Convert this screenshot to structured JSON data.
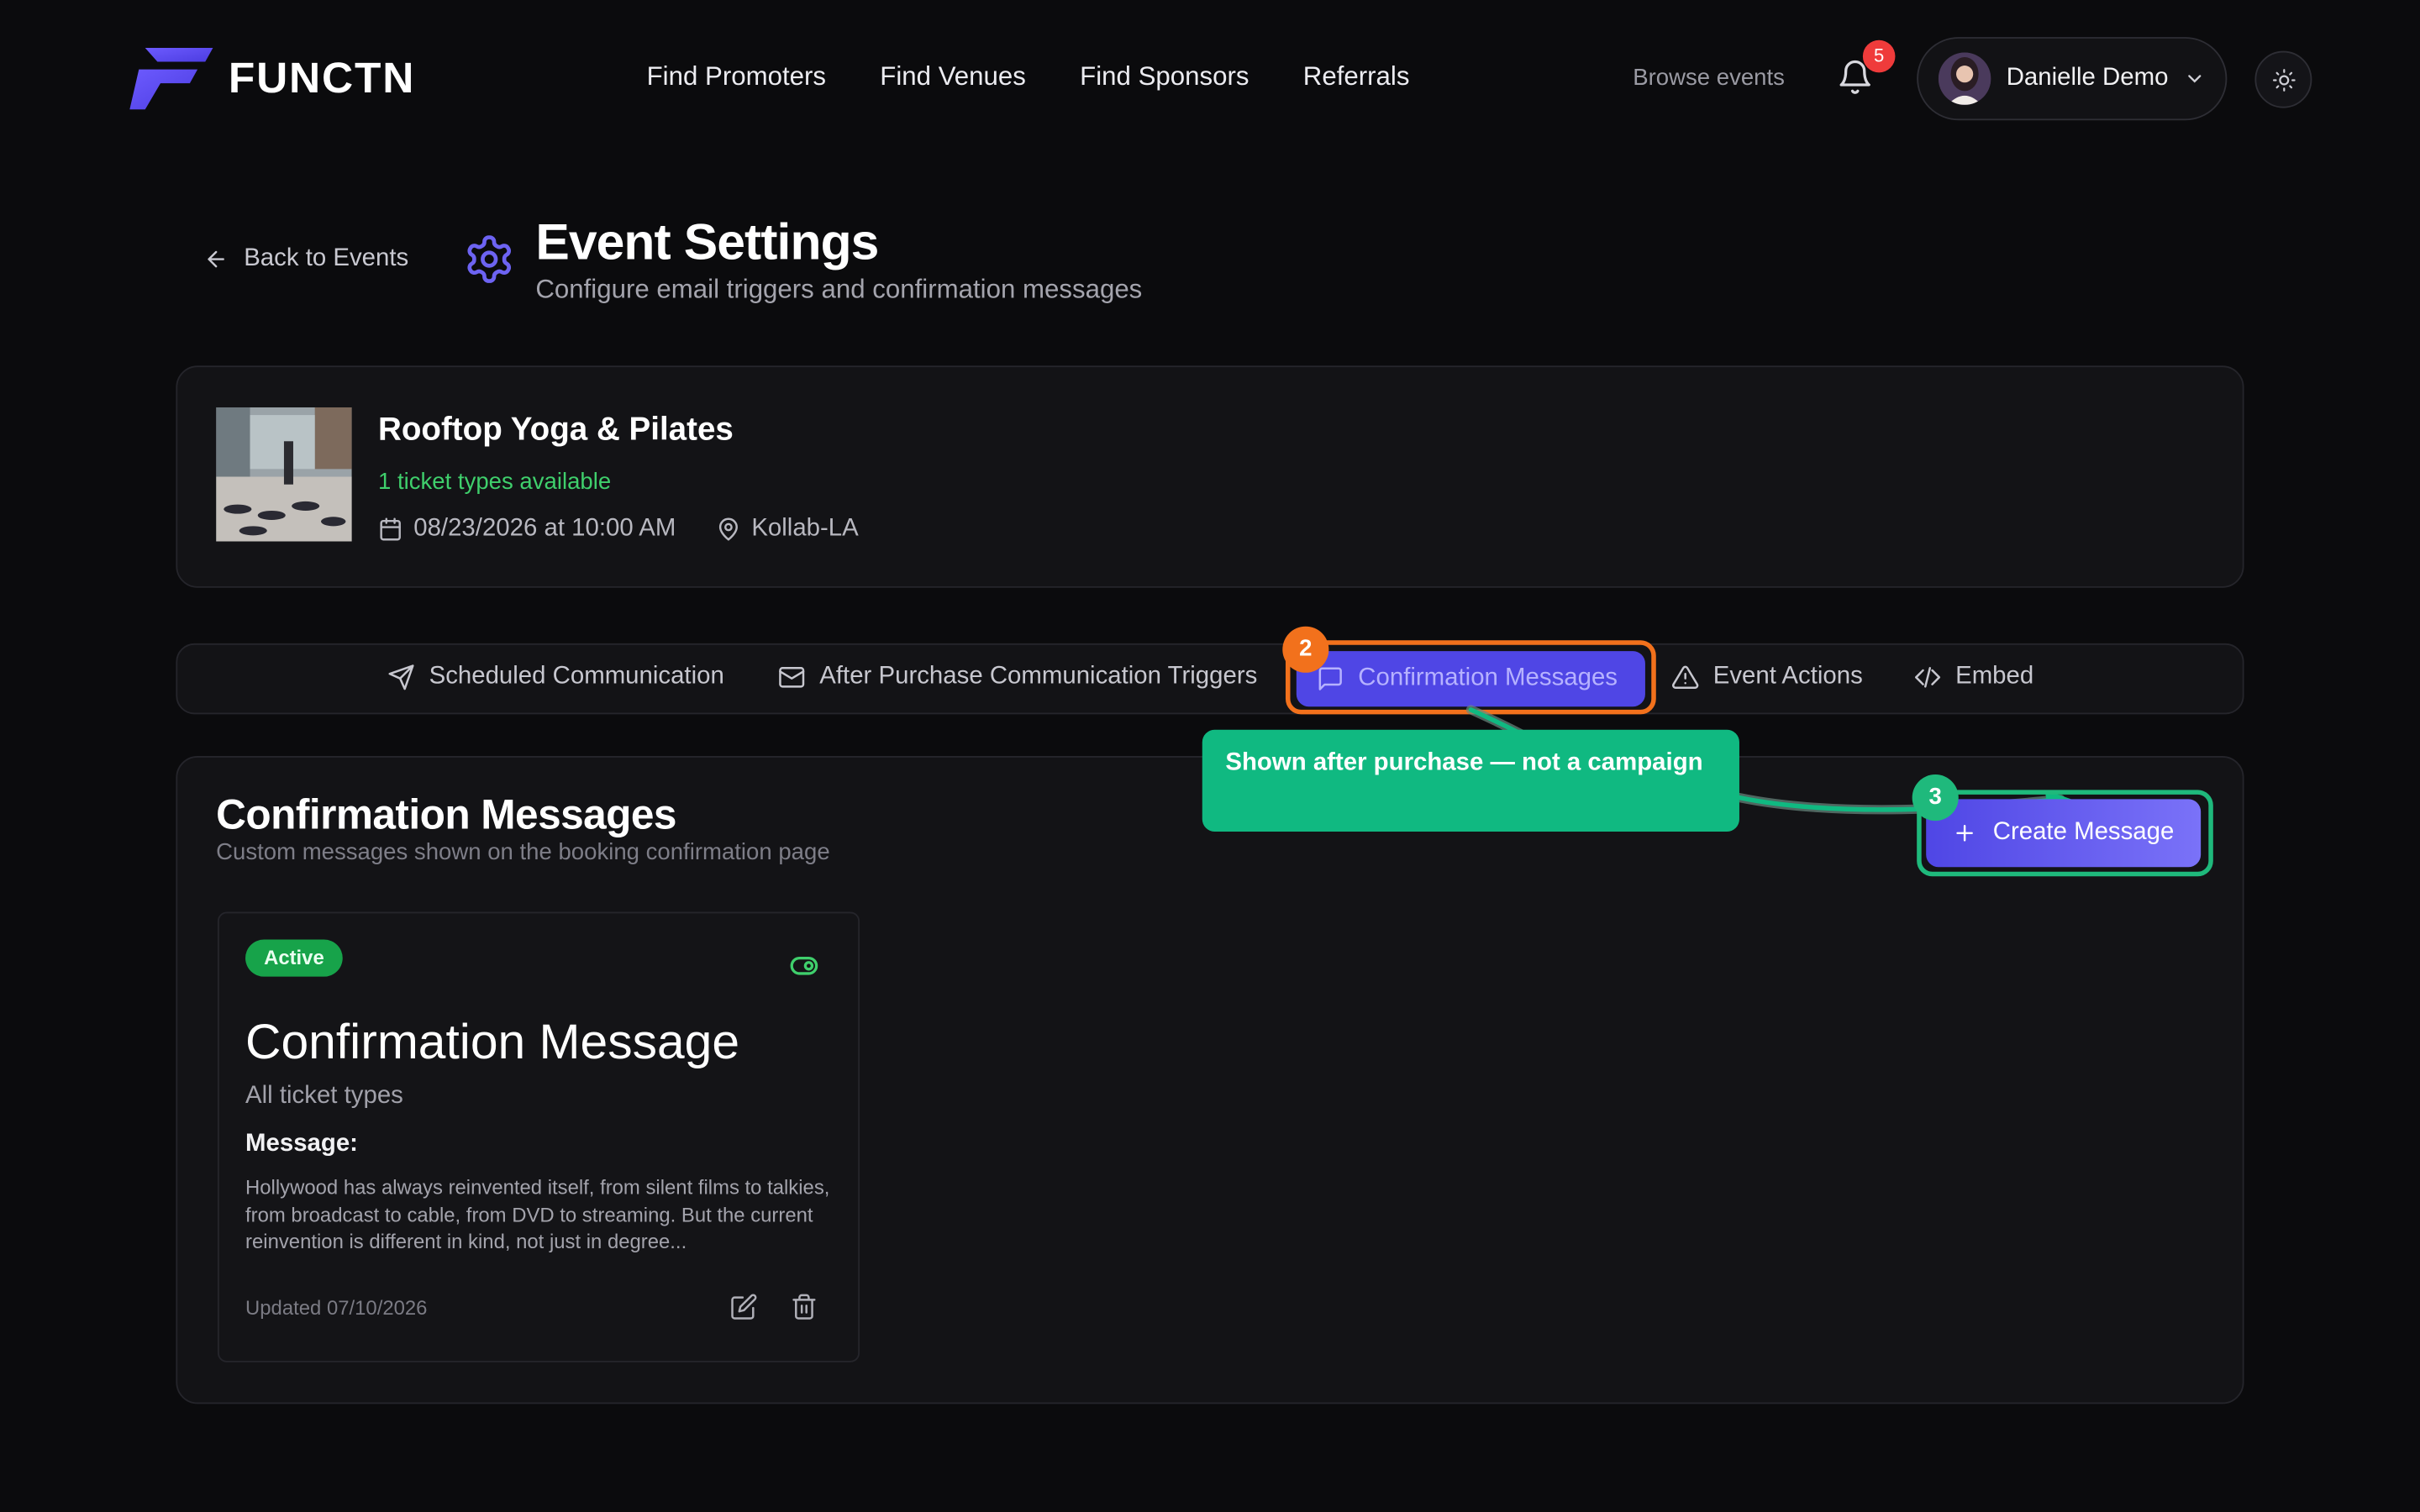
{
  "header": {
    "brand": "FUNCTN",
    "nav": [
      "Find Promoters",
      "Find Venues",
      "Find Sponsors",
      "Referrals"
    ],
    "browse_link": "Browse events",
    "notification_count": "5",
    "user_name": "Danielle Demo"
  },
  "page": {
    "back_label": "Back to Events",
    "title": "Event Settings",
    "subtitle": "Configure email triggers and confirmation messages"
  },
  "event": {
    "name": "Rooftop Yoga & Pilates",
    "ticket_info": "1 ticket types available",
    "datetime": "08/23/2026 at 10:00 AM",
    "venue": "Kollab-LA"
  },
  "tabs": [
    {
      "label": "Scheduled Communication",
      "icon": "send-icon"
    },
    {
      "label": "After Purchase Communication Triggers",
      "icon": "mail-icon"
    },
    {
      "label": "Confirmation Messages",
      "icon": "message-icon",
      "active": true
    },
    {
      "label": "Event Actions",
      "icon": "alert-triangle-icon"
    },
    {
      "label": "Embed",
      "icon": "code-icon"
    }
  ],
  "annotations": {
    "step_tab": "2",
    "step_button": "3",
    "tooltip": "Shown after purchase — not a campaign"
  },
  "section": {
    "title": "Confirmation Messages",
    "subtitle": "Custom messages shown on the booking confirmation page",
    "create_button": "Create Message"
  },
  "message_card": {
    "status": "Active",
    "title": "Confirmation Message",
    "ticket_types": "All ticket types",
    "message_label": "Message:",
    "message_body": "Hollywood has always reinvented itself, from silent films to talkies, from broadcast to cable, from DVD to streaming. But the current reinvention is different in kind, not just in degree...",
    "updated": "Updated 07/10/2026"
  },
  "colors": {
    "accent": "#4f46e5",
    "success": "#10b981",
    "highlight_orange": "#f2711c",
    "badge_red": "#ef3b3b"
  }
}
